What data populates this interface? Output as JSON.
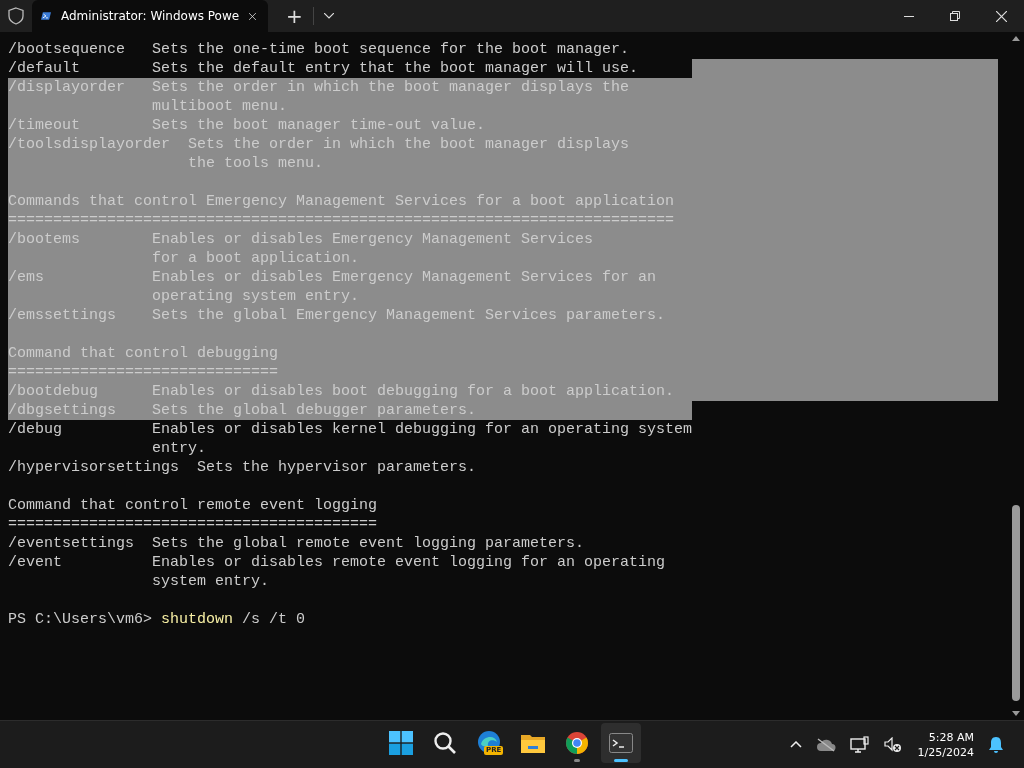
{
  "window": {
    "tab_title": "Administrator: Windows Powe",
    "new_tab": "+"
  },
  "terminal": {
    "lines": [
      {
        "text": "/bootsequence   Sets the one-time boot sequence for the boot manager.",
        "selected": false,
        "trailing_selected": false
      },
      {
        "text": "/default        Sets the default entry that the boot manager will use.",
        "selected": false,
        "trailing_selected": true
      },
      {
        "text": "/displayorder   Sets the order in which the boot manager displays the",
        "selected": true,
        "trailing_selected": true
      },
      {
        "text": "                multiboot menu.",
        "selected": true,
        "trailing_selected": true
      },
      {
        "text": "/timeout        Sets the boot manager time-out value.",
        "selected": true,
        "trailing_selected": true
      },
      {
        "text": "/toolsdisplayorder  Sets the order in which the boot manager displays",
        "selected": true,
        "trailing_selected": true
      },
      {
        "text": "                    the tools menu.",
        "selected": true,
        "trailing_selected": true
      },
      {
        "selected": true,
        "trailing_selected": true
      },
      {
        "text": "Commands that control Emergency Management Services for a boot application",
        "selected": true,
        "trailing_selected": true
      },
      {
        "text": "==========================================================================",
        "selected": true,
        "trailing_selected": true
      },
      {
        "text": "/bootems        Enables or disables Emergency Management Services",
        "selected": true,
        "trailing_selected": true
      },
      {
        "text": "                for a boot application.",
        "selected": true,
        "trailing_selected": true
      },
      {
        "text": "/ems            Enables or disables Emergency Management Services for an",
        "selected": true,
        "trailing_selected": true
      },
      {
        "text": "                operating system entry.",
        "selected": true,
        "trailing_selected": true
      },
      {
        "text": "/emssettings    Sets the global Emergency Management Services parameters.",
        "selected": true,
        "trailing_selected": true
      },
      {
        "selected": true,
        "trailing_selected": true
      },
      {
        "text": "Command that control debugging",
        "selected": true,
        "trailing_selected": true
      },
      {
        "text": "==============================",
        "selected": true,
        "trailing_selected": true
      },
      {
        "text": "/bootdebug      Enables or disables boot debugging for a boot application.",
        "selected": true,
        "trailing_selected": true
      },
      {
        "text": "/dbgsettings    Sets the global debugger parameters.",
        "selected": true,
        "trailing_selected": false
      },
      {
        "text": "/debug          Enables or disables kernel debugging for an operating system",
        "selected": false,
        "trailing_selected": false
      },
      {
        "text": "                entry.",
        "selected": false,
        "trailing_selected": false
      },
      {
        "text": "/hypervisorsettings  Sets the hypervisor parameters.",
        "selected": false,
        "trailing_selected": false
      },
      {
        "text": "Command that control remote event logging",
        "selected": false,
        "trailing_selected": false,
        "blank_before": true
      },
      {
        "text": "=========================================",
        "selected": false,
        "trailing_selected": false
      },
      {
        "text": "/eventsettings  Sets the global remote event logging parameters.",
        "selected": false,
        "trailing_selected": false
      },
      {
        "text": "/event          Enables or disables remote event logging for an operating",
        "selected": false,
        "trailing_selected": false
      },
      {
        "text": "                system entry.",
        "selected": false,
        "trailing_selected": false
      }
    ],
    "prompt": {
      "blank_before": true,
      "path": "PS C:\\Users\\vm6> ",
      "command": "shutdown",
      "args": " /s /t 0"
    }
  },
  "taskbar": {
    "apps": [
      {
        "kind": "start",
        "running": false,
        "selected": false
      },
      {
        "kind": "search",
        "running": false,
        "selected": false
      },
      {
        "kind": "edge",
        "badge": "PRE",
        "running": false,
        "selected": false
      },
      {
        "kind": "folder",
        "running": false,
        "selected": false
      },
      {
        "kind": "chrome",
        "running": true,
        "selected": false
      },
      {
        "kind": "terminal",
        "running": true,
        "selected": true
      }
    ],
    "clock": {
      "time": "5:28 AM",
      "date": "1/25/2024"
    }
  }
}
